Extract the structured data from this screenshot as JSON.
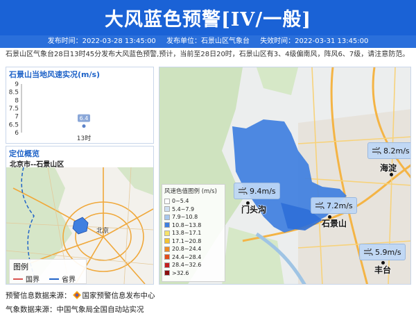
{
  "header": {
    "title": "大风蓝色预警[IV/一般]",
    "issue_time": "发布时间：2022-03-28 13:45:00",
    "issuer": "发布单位：石景山区气象台",
    "expire_time": "失效时间：2022-03-31 13:45:00"
  },
  "description": "石景山区气象台28日13时45分发布大风蓝色预警,预计，当前至28日20时，石景山区有3、4级偏南风，阵风6、7级，请注意防范。",
  "wind_panel": {
    "title": "石景山当地风速实况(m/s)"
  },
  "chart_data": {
    "type": "scatter",
    "title": "石景山当地风速实况(m/s)",
    "categories": [
      "13时"
    ],
    "values": [
      6.4
    ],
    "data_labels": [
      "6.4"
    ],
    "ylim": [
      6,
      9
    ],
    "yticks": [
      "9",
      "8.5",
      "8",
      "7.5",
      "7",
      "6.5",
      "6"
    ],
    "xlabel": "",
    "ylabel": "",
    "grid": false
  },
  "location_panel": {
    "title": "定位概览",
    "subtitle": "北京市--石景山区",
    "city_label": "北京",
    "legend_title": "图例",
    "legend_national": "国界",
    "legend_provincial": "省界",
    "colors": {
      "national": "#d9534f",
      "provincial": "#1f63c8"
    }
  },
  "map": {
    "legend_title": "风速色值图例 (m/s)",
    "legend": [
      {
        "label": "0~5.4",
        "color": "#ffffff"
      },
      {
        "label": "5.4~7.9",
        "color": "#cfe0f2"
      },
      {
        "label": "7.9~10.8",
        "color": "#a7c8ee"
      },
      {
        "label": "10.8~13.8",
        "color": "#3f7fe0"
      },
      {
        "label": "13.8~17.1",
        "color": "#f7e36a"
      },
      {
        "label": "17.1~20.8",
        "color": "#f3c531"
      },
      {
        "label": "20.8~24.4",
        "color": "#f08c23"
      },
      {
        "label": "24.4~28.4",
        "color": "#e24d1a"
      },
      {
        "label": "28.4~32.6",
        "color": "#c41f1f"
      },
      {
        "label": ">32.6",
        "color": "#8b0d0d"
      }
    ],
    "stations": [
      {
        "name": "海淀",
        "speed": "8.2m/s"
      },
      {
        "name": "门头沟",
        "speed": "9.4m/s"
      },
      {
        "name": "石景山",
        "speed": "7.2m/s"
      },
      {
        "name": "丰台",
        "speed": "5.9m/s"
      }
    ]
  },
  "footer": {
    "warning_source_label": "预警信息数据来源：",
    "warning_source_value": "国家预警信息发布中心",
    "weather_source": "气象数据来源：中国气象局全国自动站实况"
  }
}
